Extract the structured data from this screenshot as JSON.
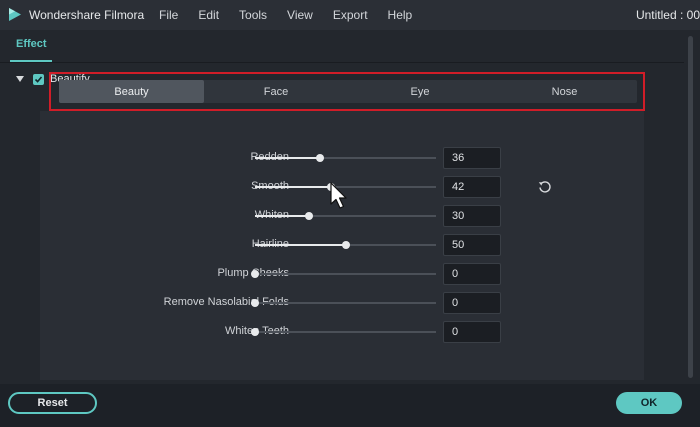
{
  "app": {
    "name": "Wondershare Filmora",
    "doc_title": "Untitled : 00",
    "logo_icon": "filmora-logo-icon",
    "menu": [
      "File",
      "Edit",
      "Tools",
      "View",
      "Export",
      "Help"
    ]
  },
  "panel": {
    "tab_label": "Effect",
    "section_label": "Beautify",
    "section_checked": true,
    "subtabs": [
      "Beauty",
      "Face",
      "Eye",
      "Nose"
    ],
    "active_subtab": "Beauty",
    "sliders": [
      {
        "label": "Redden",
        "value": "36",
        "level": 0.36
      },
      {
        "label": "Smooth",
        "value": "42",
        "level": 0.42
      },
      {
        "label": "Whiten",
        "value": "30",
        "level": 0.3
      },
      {
        "label": "Hairline",
        "value": "50",
        "level": 0.5
      },
      {
        "label": "Plump Cheeks",
        "value": "0",
        "level": 0
      },
      {
        "label": "Remove Nasolabial Folds",
        "value": "0",
        "level": 0
      },
      {
        "label": "Whiten Teeth",
        "value": "0",
        "level": 0
      }
    ],
    "reset_icon": "reset-icon"
  },
  "footer": {
    "reset_label": "Reset",
    "ok_label": "OK"
  },
  "colors": {
    "accent": "#5ec8c2",
    "highlight_box": "#d01d28"
  }
}
